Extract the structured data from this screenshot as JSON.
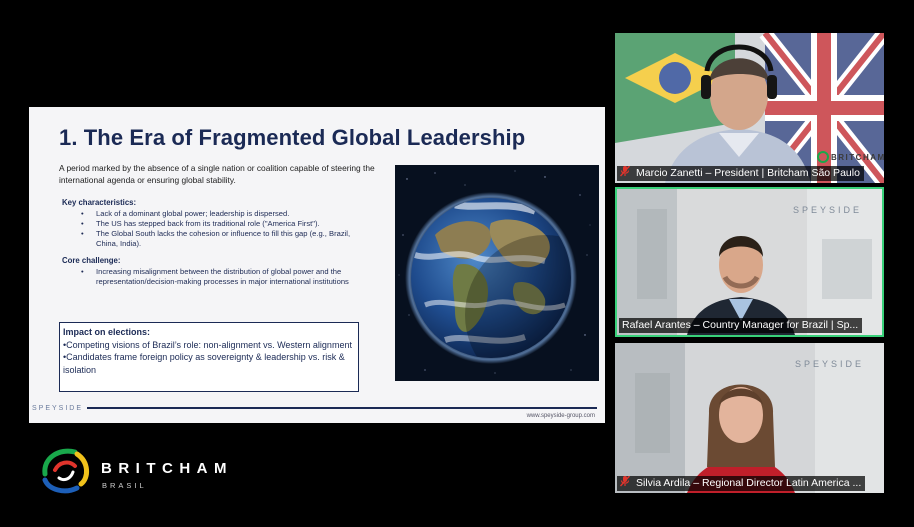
{
  "slide": {
    "title": "1. The Era of Fragmented Global Leadership",
    "intro": "A period marked by the absence of a single nation or coalition capable of steering the international agenda or ensuring global stability.",
    "sections": [
      {
        "heading": "Key characteristics:",
        "items": [
          "Lack of a dominant global power; leadership is dispersed.",
          "The US has stepped back from its traditional role (\"America First\").",
          "The Global South lacks the cohesion or influence to fill this gap (e.g., Brazil, China, India)."
        ]
      },
      {
        "heading": "Core challenge:",
        "items": [
          "Increasing misalignment between the distribution of global power and the representation/decision-making processes in major international institutions"
        ]
      }
    ],
    "impact": {
      "heading": "Impact on elections:",
      "line1": "•Competing visions of Brazil’s role: non-alignment vs. Western alignment",
      "line2": "•Candidates frame foreign policy as sovereignty & leadership vs. risk & isolation"
    },
    "footer_brand": "SPEYSIDE",
    "footer_url": "www.speyside-group.com"
  },
  "logo": {
    "word": "BRITCHAM",
    "sub": "BRASIL"
  },
  "participants": [
    {
      "name": "Marcio Zanetti – President | Britcham São Paulo",
      "muted": true,
      "speaking": false,
      "background_text": "BRITCHAM"
    },
    {
      "name": "Rafael Arantes – Country Manager for Brazil | Sp...",
      "muted": false,
      "speaking": true,
      "background_text": "SPEYSIDE"
    },
    {
      "name": "Silvia Ardila – Regional Director Latin America ...",
      "muted": true,
      "speaking": false,
      "background_text": "SPEYSIDE"
    }
  ],
  "colors": {
    "slide_navy": "#1b2a55",
    "active_speaker_border": "#39d17a",
    "muted_mic": "#e0342c"
  }
}
